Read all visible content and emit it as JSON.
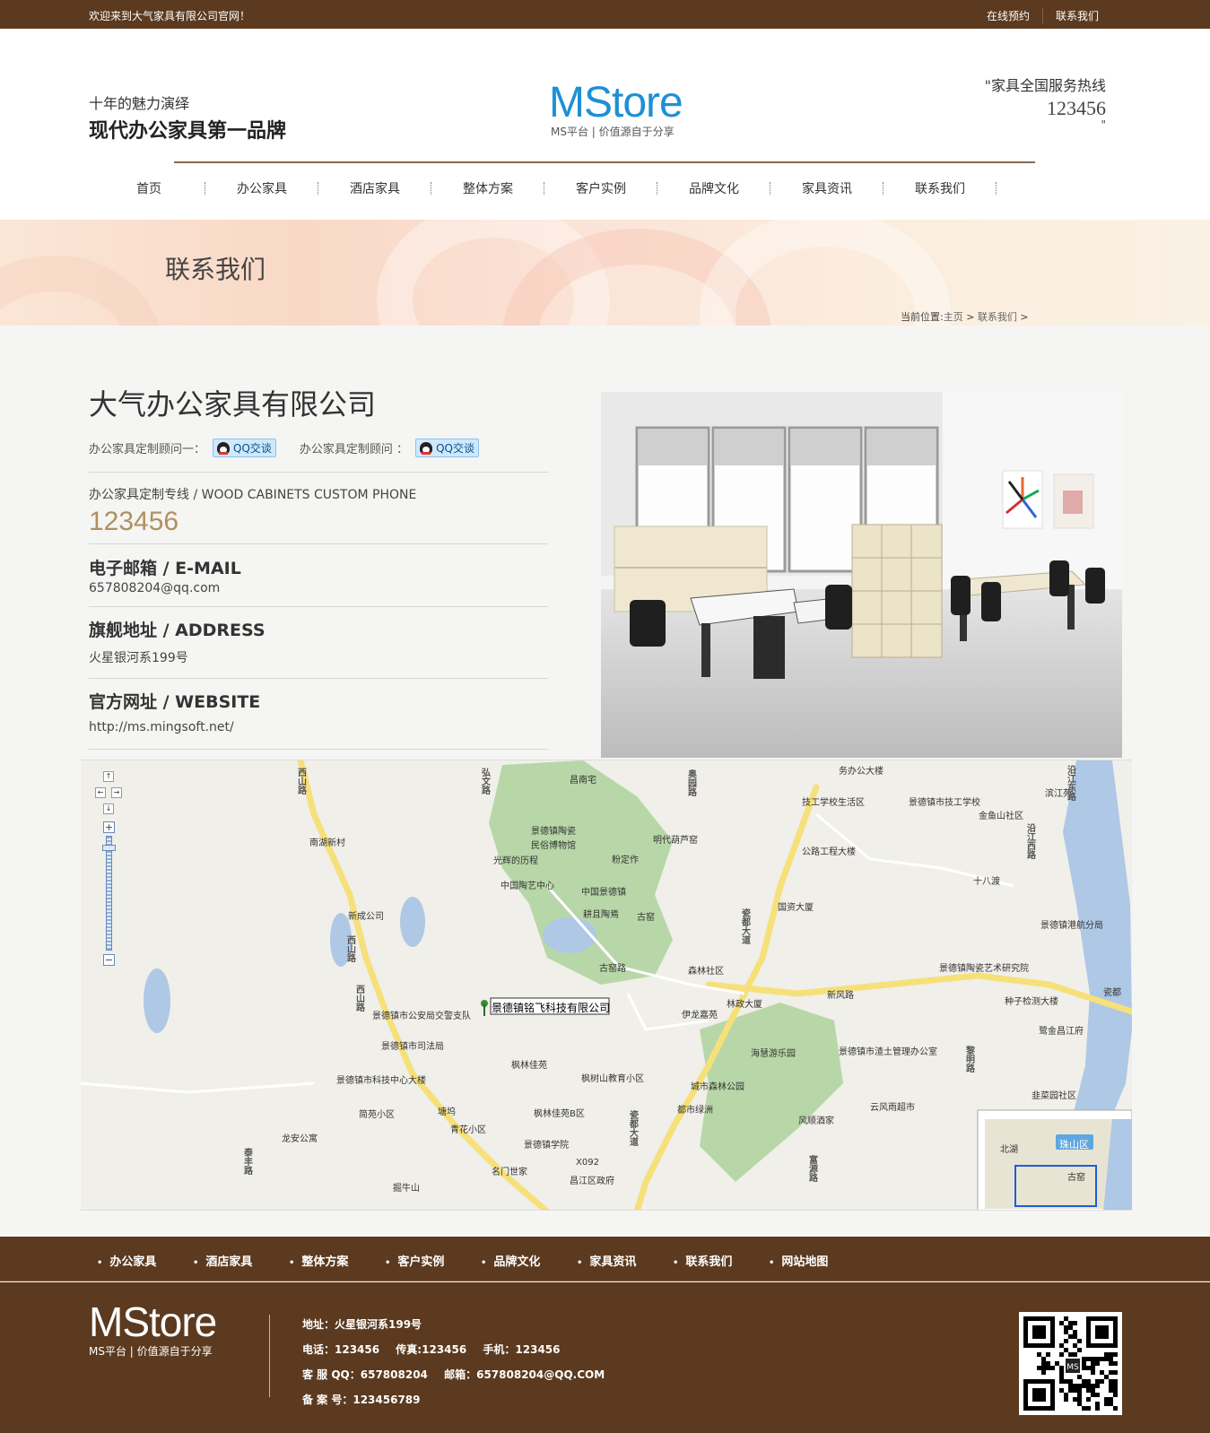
{
  "topbar": {
    "welcome": "欢迎来到大气家具有限公司官网！",
    "links": [
      "在线预约",
      "联系我们"
    ]
  },
  "header": {
    "slogan_line1": "十年的魅力演绎",
    "slogan_line2": "现代办公家具第一品牌",
    "logo_name": "MStore",
    "logo_sub": "MS平台 | 价值源自于分享",
    "hotline_label": "\"家具全国服务热线",
    "hotline_number": "123456",
    "hotline_close": "\""
  },
  "nav": [
    "首页",
    "办公家具",
    "酒店家具",
    "整体方案",
    "客户实例",
    "品牌文化",
    "家具资讯",
    "联系我们"
  ],
  "banner": {
    "title": "联系我们",
    "crumb_prefix": "当前位置:",
    "crumb_home": "主页",
    "crumb_sep1": " > ",
    "crumb_current": "联系我们",
    "crumb_sep2": " >"
  },
  "contact": {
    "company": "大气办公家具有限公司",
    "advisor1_label": "办公家具定制顾问一：",
    "advisor2_label": "办公家具定制顾问 ：",
    "qq_button": "QQ交谈",
    "phone_label": "办公家具定制专线 / WOOD CABINETS CUSTOM PHONE",
    "phone": "123456",
    "email_title": "电子邮箱 / E-MAIL",
    "email": "657808204@qq.com",
    "address_title": "旗舰地址 / ADDRESS",
    "address": "火星银河系199号",
    "website_title": "官方网址 / WEBSITE",
    "website": "http://ms.mingsoft.net/"
  },
  "map": {
    "marker_label": "景德镇铭飞科技有限公司",
    "overview_labels": [
      "北湖",
      "珠山区",
      "古窑"
    ],
    "labels": [
      {
        "t": "西山路"
      },
      {
        "t": "南湖新村"
      },
      {
        "t": "新成公司"
      },
      {
        "t": "西山路"
      },
      {
        "t": "西山路"
      },
      {
        "t": "景德镇市公安局交警支队"
      },
      {
        "t": "景德镇市司法局"
      },
      {
        "t": "景德镇市科技中心大楼"
      },
      {
        "t": "简苑小区"
      },
      {
        "t": "龙安公寓"
      },
      {
        "t": "泰丰路"
      },
      {
        "t": "掘牛山"
      },
      {
        "t": "弘文路"
      },
      {
        "t": "昌南宅"
      },
      {
        "t": "景德镇陶瓷"
      },
      {
        "t": "民俗博物馆"
      },
      {
        "t": "光辉的历程"
      },
      {
        "t": "粉定作"
      },
      {
        "t": "中国陶艺中心"
      },
      {
        "t": "中国景德镇"
      },
      {
        "t": "耕且陶焉"
      },
      {
        "t": "古窑"
      },
      {
        "t": "明代葫芦窑"
      },
      {
        "t": "古窑路"
      },
      {
        "t": "枫林佳苑"
      },
      {
        "t": "枫林佳苑B区"
      },
      {
        "t": "塘坞"
      },
      {
        "t": "青花小区"
      },
      {
        "t": "名门世家"
      },
      {
        "t": "景德镇学院"
      },
      {
        "t": "X092"
      },
      {
        "t": "昌江区政府"
      },
      {
        "t": "枫树山教育小区"
      },
      {
        "t": "伊龙嘉苑"
      },
      {
        "t": "林政大厦"
      },
      {
        "t": "森林社区"
      },
      {
        "t": "奥园路"
      },
      {
        "t": "瓷都大道"
      },
      {
        "t": "瓷都大道"
      },
      {
        "t": "新风路"
      },
      {
        "t": "国资大厦"
      },
      {
        "t": "公路工程大楼"
      },
      {
        "t": "技工学校生活区"
      },
      {
        "t": "景德镇市技工学校"
      },
      {
        "t": "金鱼山社区"
      },
      {
        "t": "滨江苑"
      },
      {
        "t": "沿江东路"
      },
      {
        "t": "沿江西路"
      },
      {
        "t": "十八渡"
      },
      {
        "t": "景德镇港航分局"
      },
      {
        "t": "景德镇陶瓷艺术研究院"
      },
      {
        "t": "种子检测大楼"
      },
      {
        "t": "鹭金昌江府"
      },
      {
        "t": "瓷都"
      },
      {
        "t": "景德镇市渣土管理办公室"
      },
      {
        "t": "海慧游乐园"
      },
      {
        "t": "城市森林公园"
      },
      {
        "t": "都市绿洲"
      },
      {
        "t": "云风雨超市"
      },
      {
        "t": "风顺酒家"
      },
      {
        "t": "韭菜园社区"
      },
      {
        "t": "黎明路"
      },
      {
        "t": "富源路"
      },
      {
        "t": "务办公大楼"
      }
    ]
  },
  "footer_nav": [
    "办公家具",
    "酒店家具",
    "整体方案",
    "客户实例",
    "品牌文化",
    "家具资讯",
    "联系我们",
    "网站地图"
  ],
  "footer": {
    "logo_name": "MStore",
    "logo_sub": "MS平台 | 价值源自于分享",
    "address": "地址：火星银河系199号",
    "tel": "电话：123456",
    "fax": "传真:123456",
    "mobile": "手机：123456",
    "qq": "客 服 QQ：657808204",
    "mail": "邮箱：657808204@QQ.COM",
    "icp": "备 案 号：123456789",
    "qr_center": "MS"
  }
}
